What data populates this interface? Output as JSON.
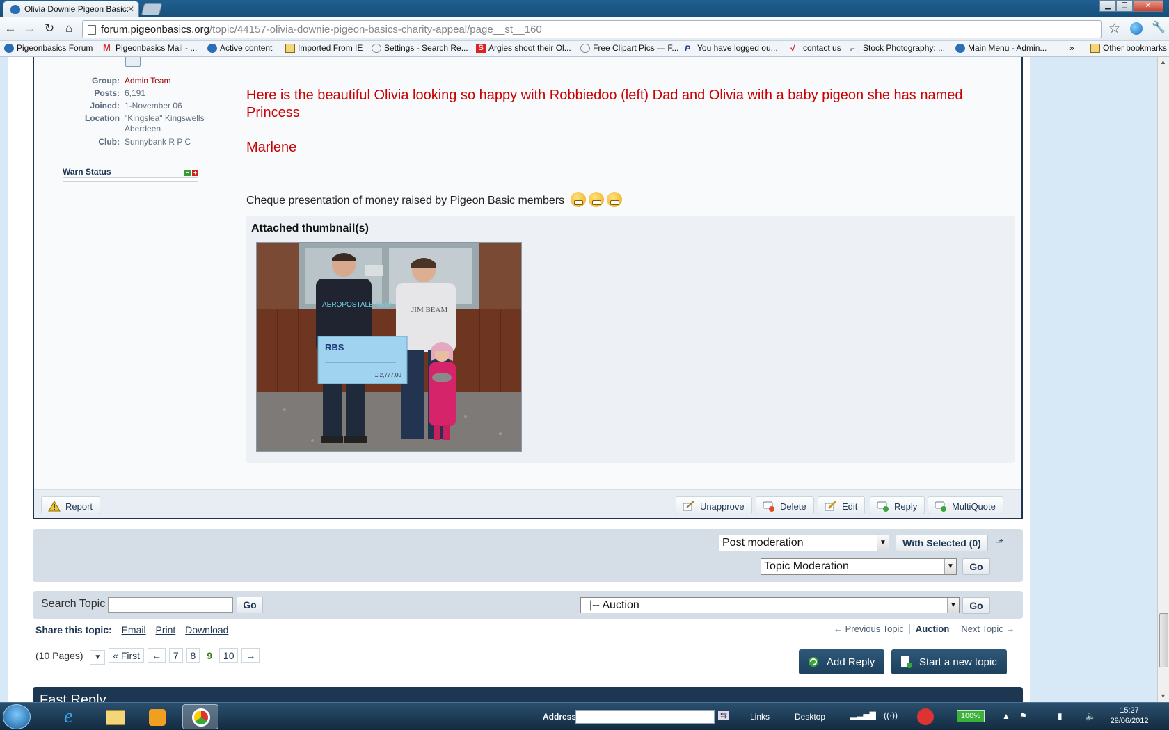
{
  "browser": {
    "tab_title": "Olivia Downie Pigeon Basic:",
    "url_host": "forum.pigeonbasics.org",
    "url_path": "/topic/44157-olivia-downie-pigeon-basics-charity-appeal/page__st__160"
  },
  "bookmarks": {
    "items": [
      {
        "label": "Pigeonbasics Forum",
        "icon": "pigeon-icon"
      },
      {
        "label": "Pigeonbasics Mail - ...",
        "icon": "gmail-icon"
      },
      {
        "label": "Active content",
        "icon": "pigeon-icon"
      },
      {
        "label": "Imported From IE",
        "icon": "folder-icon"
      },
      {
        "label": "Settings - Search Re...",
        "icon": "gear-icon"
      },
      {
        "label": "Argies shoot their Ol...",
        "icon": "s-logo-icon"
      },
      {
        "label": "Free Clipart Pics — F...",
        "icon": "globe-icon"
      },
      {
        "label": "You have logged ou...",
        "icon": "paypal-icon"
      },
      {
        "label": "contact us",
        "icon": "check-icon"
      },
      {
        "label": "Stock Photography: ...",
        "icon": "camera-icon"
      },
      {
        "label": "Main Menu - Admin...",
        "icon": "pigeon-icon"
      }
    ],
    "other": "Other bookmarks"
  },
  "profile": {
    "group_label": "Group:",
    "group_value": "Admin Team",
    "posts_label": "Posts:",
    "posts_value": "6,191",
    "joined_label": "Joined:",
    "joined_value": "1-November 06",
    "location_label": "Location",
    "location_value": "\"Kingslea\" Kingswells Aberdeen",
    "club_label": "Club:",
    "club_value": "Sunnybank R P C",
    "warn_status": "Warn Status"
  },
  "post": {
    "message": "Here is the beautiful Olivia looking so happy with Robbiedoo (left) Dad and Olivia with a baby pigeon she has named Princess",
    "signature": "Marlene",
    "cheque_text": "Cheque presentation of money raised by Pigeon Basic members",
    "attachments_heading": "Attached thumbnail(s)",
    "photo_cheque_bank": "RBS",
    "photo_shirt_text": "AEROPOSTALE NEW YORK",
    "photo_shirt2_text": "JIM BEAM",
    "photo_amount": "£ 2,777.00"
  },
  "post_actions": {
    "report": "Report",
    "unapprove": "Unapprove",
    "delete": "Delete",
    "edit": "Edit",
    "reply": "Reply",
    "multiquote": "MultiQuote"
  },
  "moderation": {
    "post_moderation": "Post moderation",
    "with_selected": "With Selected (0)",
    "topic_moderation": "Topic Moderation",
    "go": "Go"
  },
  "search": {
    "label": "Search Topic",
    "go": "Go",
    "forum_jump": "|-- Auction",
    "jump_go": "Go"
  },
  "share": {
    "label": "Share this topic:",
    "email": "Email",
    "print": "Print",
    "download": "Download"
  },
  "topic_nav": {
    "prev": "← Previous Topic",
    "current": "Auction",
    "next": "Next Topic →"
  },
  "pagination": {
    "pages": "(10 Pages)",
    "first": "« First",
    "prev": "←",
    "p7": "7",
    "p8": "8",
    "current": "9",
    "p10": "10",
    "next": "→"
  },
  "buttons": {
    "add_reply": "Add Reply",
    "new_topic": "Start a new topic"
  },
  "fast_reply": "Fast Reply",
  "taskbar": {
    "address_label": "Address",
    "links": "Links",
    "desktop": "Desktop",
    "battery": "100%",
    "time": "15:27",
    "date": "29/06/2012"
  },
  "colors": {
    "accent": "#1d3652",
    "message_red": "#cc0000",
    "admin_red": "#a00000"
  }
}
